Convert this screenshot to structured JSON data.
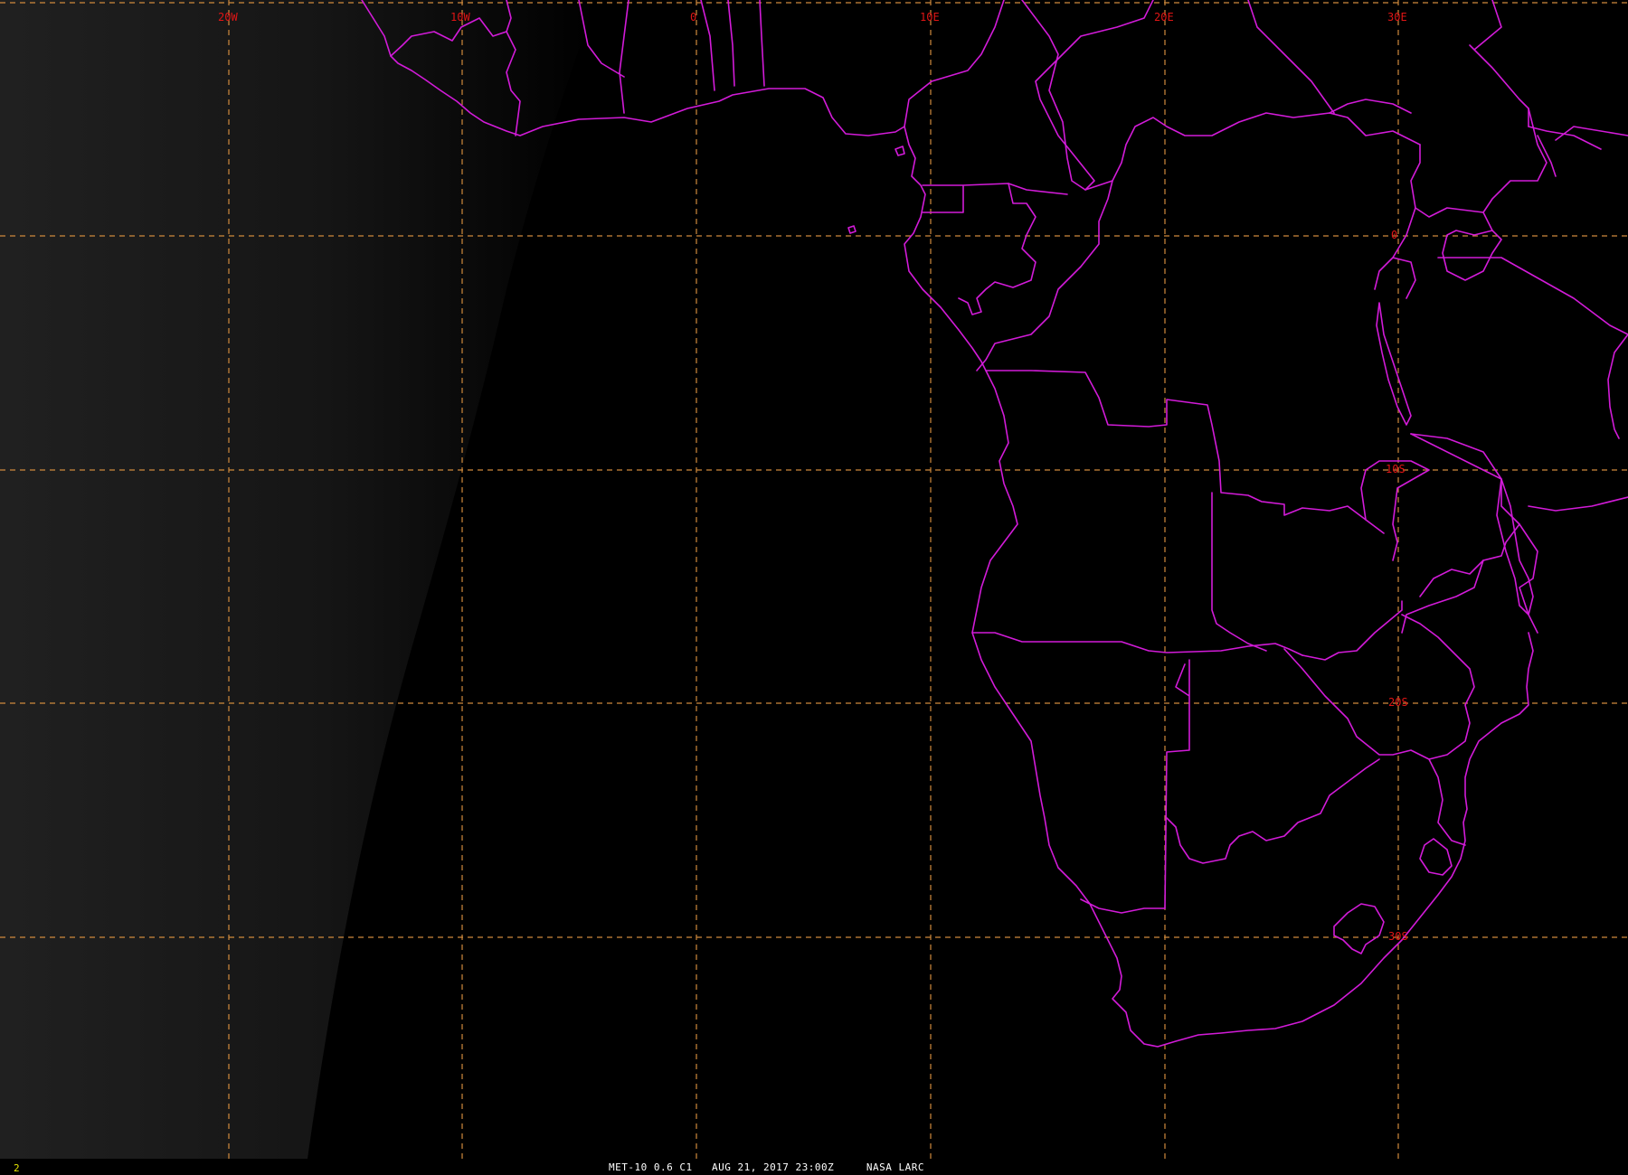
{
  "map": {
    "type": "satellite-imagery-with-graticule",
    "projection": "geostationary full-disk sector",
    "coverage": "West / Southern Africa and adjacent Atlantic",
    "longitude_labels": [
      "20W",
      "10W",
      "0",
      "10E",
      "20E",
      "30E"
    ],
    "latitude_labels": [
      "0",
      "10S",
      "20S",
      "30S"
    ],
    "graticule_spacing_deg": 10,
    "colors": {
      "background": "#000000",
      "graticule": "#d08a3c",
      "grid_label": "#e01515",
      "political_borders": "#d21bd8",
      "frame_number": "#e6e600",
      "caption": "#ffffff"
    },
    "imagery_note": "nighttime visible channel; faint sunglint band at far west"
  },
  "footer": {
    "frame_number": "2",
    "caption": "MET-10 0.6 C1   AUG 21, 2017 23:00Z     NASA LARC"
  }
}
